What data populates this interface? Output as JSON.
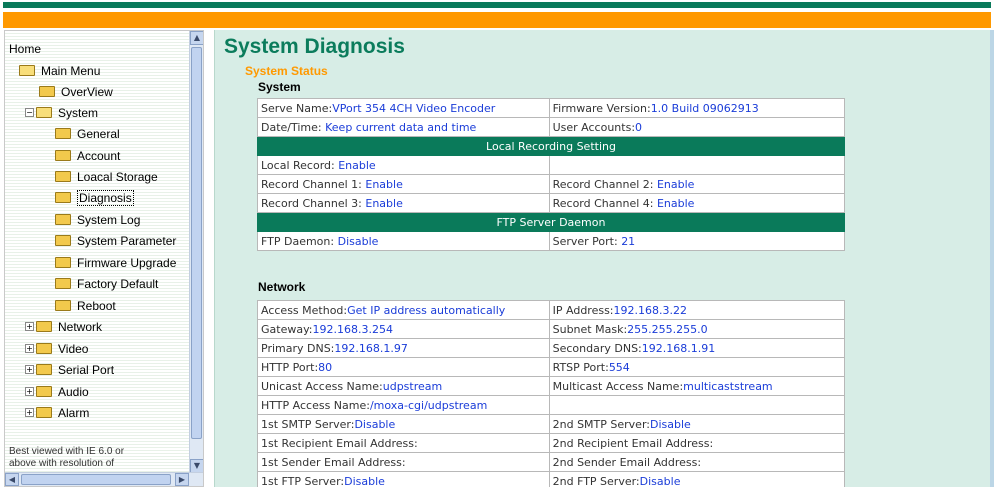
{
  "sidebar": {
    "items": [
      {
        "label": "Home"
      },
      {
        "label": "Main Menu"
      },
      {
        "label": "OverView"
      },
      {
        "label": "System"
      },
      {
        "label": "General"
      },
      {
        "label": "Account"
      },
      {
        "label": "Loacal Storage"
      },
      {
        "label": "Diagnosis"
      },
      {
        "label": "System Log"
      },
      {
        "label": "System Parameter"
      },
      {
        "label": "Firmware Upgrade"
      },
      {
        "label": "Factory Default"
      },
      {
        "label": "Reboot"
      },
      {
        "label": "Network"
      },
      {
        "label": "Video"
      },
      {
        "label": "Serial Port"
      },
      {
        "label": "Audio"
      },
      {
        "label": "Alarm"
      }
    ],
    "note_line1": "Best viewed with IE 6.0 or",
    "note_line2": "above with resolution of"
  },
  "main": {
    "title": "System Diagnosis",
    "section": "System Status",
    "system": {
      "heading": "System",
      "serve_name_label": "Serve Name:",
      "serve_name": "VPort 354 4CH Video Encoder",
      "firmware_label": "Firmware Version:",
      "firmware": "1.0 Build 09062913",
      "datetime_label": "Date/Time: ",
      "datetime": "Keep current data and time",
      "accounts_label": "User Accounts:",
      "accounts": "0",
      "local_rec_header": "Local Recording Setting",
      "local_record_label": "Local Record: ",
      "local_record": "Enable",
      "ch1_label": "Record Channel 1: ",
      "ch1": "Enable",
      "ch2_label": "Record Channel 2: ",
      "ch2": "Enable",
      "ch3_label": "Record Channel 3: ",
      "ch3": "Enable",
      "ch4_label": "Record Channel 4: ",
      "ch4": "Enable",
      "ftp_header": "FTP Server Daemon",
      "ftp_daemon_label": "FTP Daemon: ",
      "ftp_daemon": "Disable",
      "server_port_label": "Server Port: ",
      "server_port": "21"
    },
    "network": {
      "heading": "Network",
      "access_label": "Access Method:",
      "access": "Get IP address automatically",
      "ip_label": "IP Address:",
      "ip": "192.168.3.22",
      "gateway_label": "Gateway:",
      "gateway": "192.168.3.254",
      "subnet_label": "Subnet Mask:",
      "subnet": "255.255.255.0",
      "pdns_label": "Primary DNS:",
      "pdns": "192.168.1.97",
      "sdns_label": "Secondary DNS:",
      "sdns": "192.168.1.91",
      "http_label": "HTTP Port:",
      "http": "80",
      "rtsp_label": "RTSP Port:",
      "rtsp": "554",
      "unicast_label": "Unicast Access Name:",
      "unicast": "udpstream",
      "multicast_label": "Multicast Access Name:",
      "multicast": "multicaststream",
      "httpname_label": "HTTP Access Name:",
      "httpname": "/moxa-cgi/udpstream",
      "smtp1_label": "1st SMTP Server:",
      "smtp1": "Disable",
      "smtp2_label": "2nd SMTP Server:",
      "smtp2": "Disable",
      "rcpt1_label": "1st Recipient Email Address:",
      "rcpt2_label": "2nd Recipient Email Address:",
      "sender1_label": "1st Sender Email Address:",
      "sender2_label": "2nd Sender Email Address:",
      "ftp1_label": "1st FTP Server:",
      "ftp1": "Disable",
      "ftp2_label": "2nd FTP Server:",
      "ftp2": "Disable"
    }
  },
  "colors": {
    "brand_green": "#0a7a5a",
    "accent_orange": "#ff9900",
    "value_blue": "#1a3cd8",
    "content_bg": "#d7ede6"
  }
}
